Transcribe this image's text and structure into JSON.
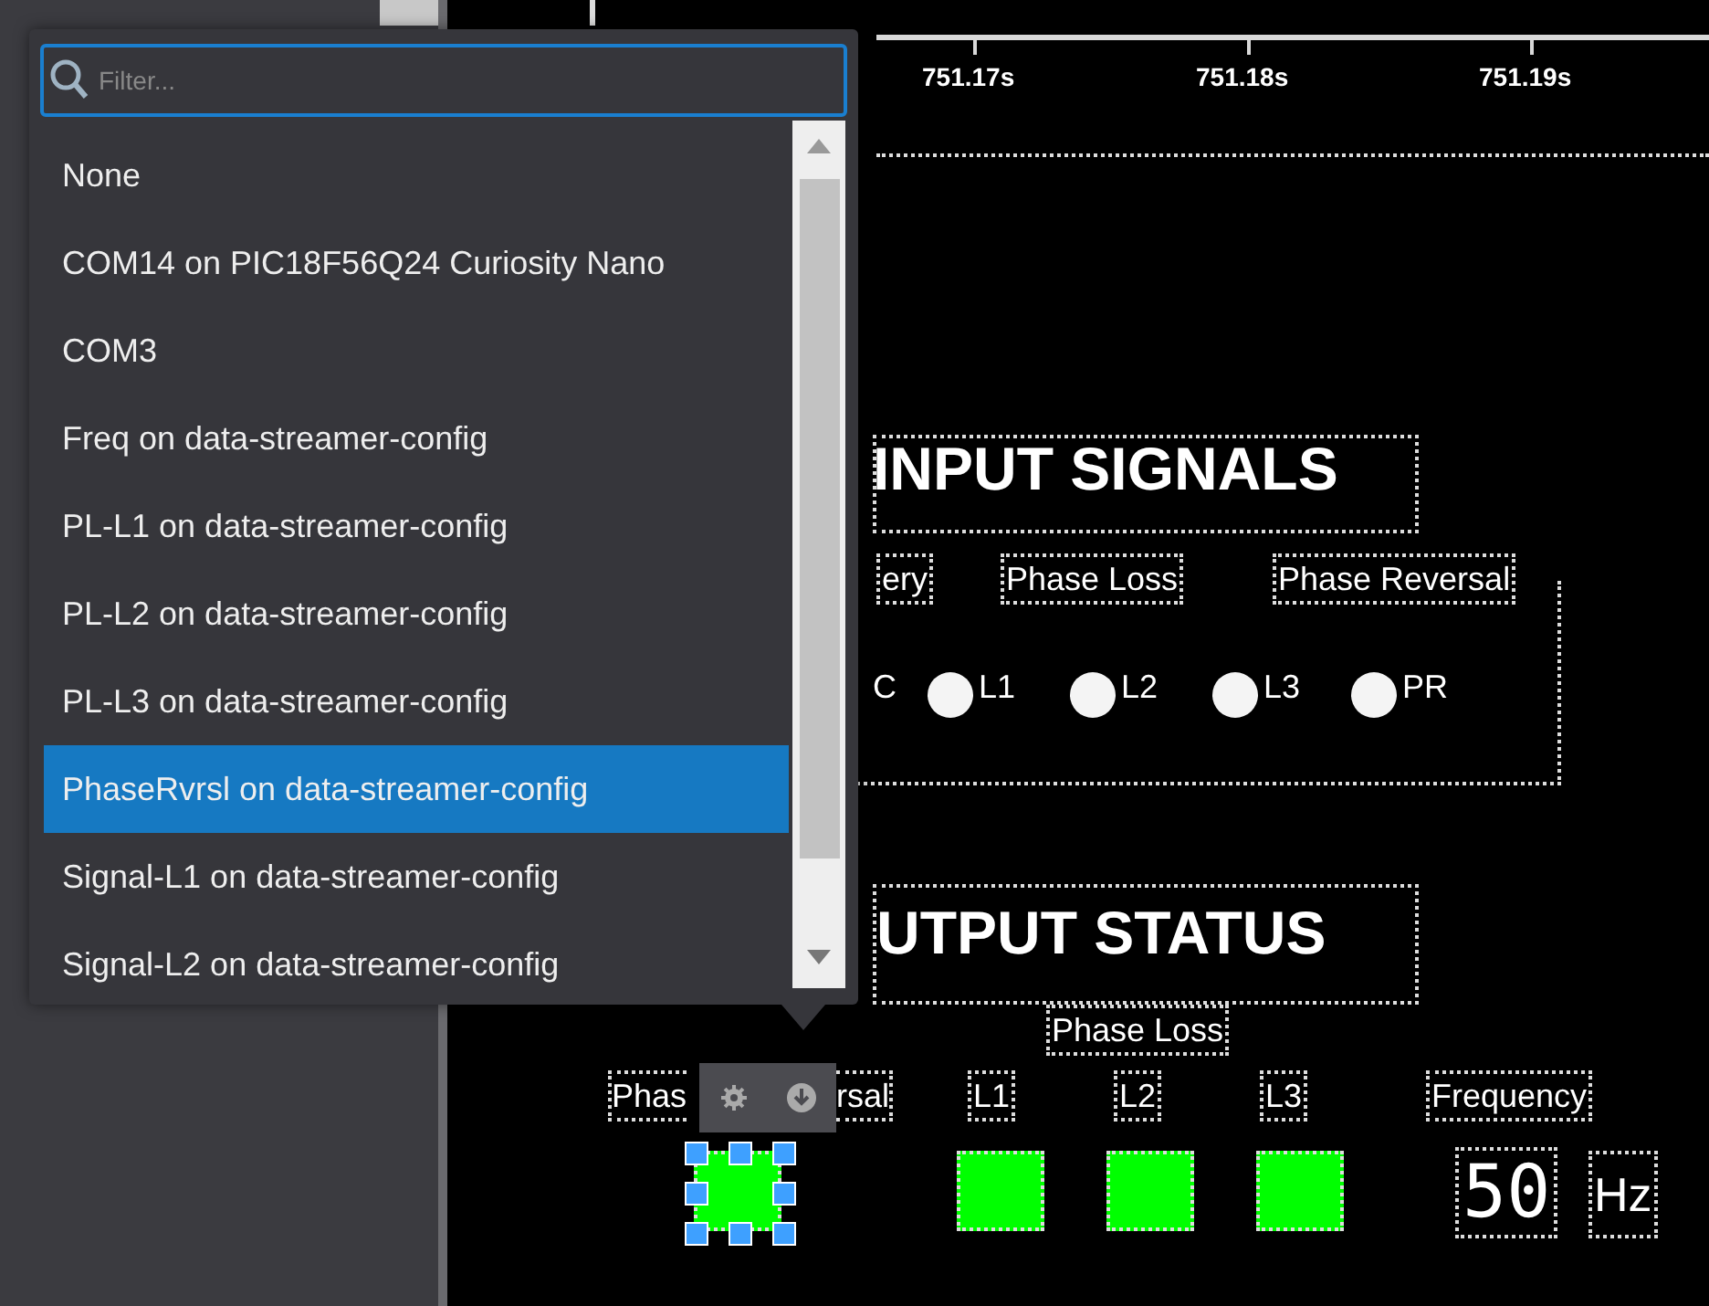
{
  "timeline": {
    "ticks": [
      "751.17s",
      "751.18s",
      "751.19s"
    ]
  },
  "filter": {
    "placeholder": "Filter..."
  },
  "port_list": {
    "items": [
      {
        "label": "None",
        "selected": false
      },
      {
        "label": "COM14 on PIC18F56Q24 Curiosity Nano",
        "selected": false
      },
      {
        "label": "COM3",
        "selected": false
      },
      {
        "label": "Freq on data-streamer-config",
        "selected": false
      },
      {
        "label": "PL-L1 on data-streamer-config",
        "selected": false
      },
      {
        "label": "PL-L2 on data-streamer-config",
        "selected": false
      },
      {
        "label": "PL-L3 on data-streamer-config",
        "selected": false
      },
      {
        "label": "PhaseRvrsl on data-streamer-config",
        "selected": true
      },
      {
        "label": "Signal-L1 on data-streamer-config",
        "selected": false
      },
      {
        "label": "Signal-L2 on data-streamer-config",
        "selected": false
      }
    ]
  },
  "input_signals": {
    "title": "INPUT SIGNALS",
    "groups": [
      "ery",
      "Phase Loss",
      "Phase Reversal"
    ],
    "lead_label": "C",
    "indicators": [
      {
        "label": "L1",
        "on": false
      },
      {
        "label": "L2",
        "on": false
      },
      {
        "label": "L3",
        "on": false
      },
      {
        "label": "PR",
        "on": false
      }
    ]
  },
  "output_status": {
    "title": "UTPUT STATUS",
    "phase_loss_label": "Phase Loss",
    "phase_reversal_label": [
      "Phas",
      "rsal"
    ],
    "leds": [
      {
        "on": true,
        "selected": true
      },
      {
        "label": "L1",
        "on": true,
        "selected": false
      },
      {
        "label": "L2",
        "on": true,
        "selected": false
      },
      {
        "label": "L3",
        "on": true,
        "selected": false
      }
    ],
    "frequency": {
      "label": "Frequency",
      "value": "50",
      "unit": "Hz"
    }
  }
}
